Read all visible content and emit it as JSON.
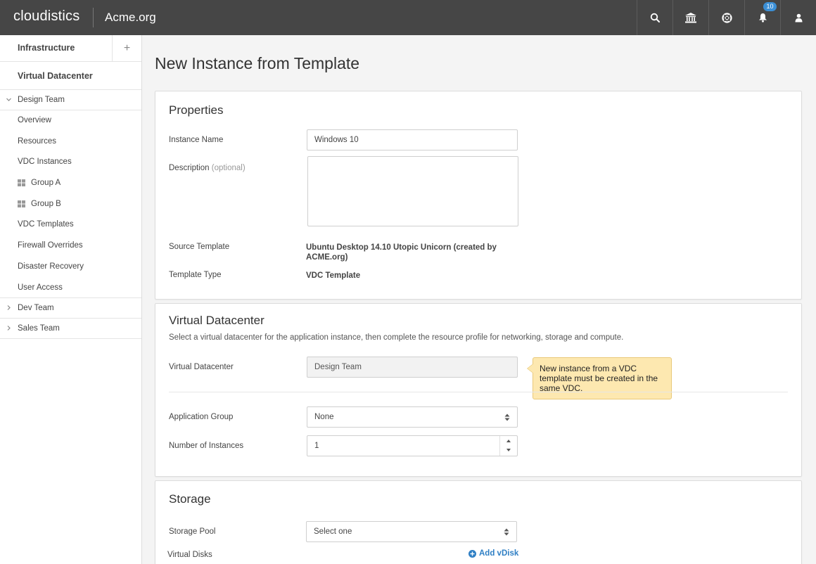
{
  "header": {
    "brand": "cloudistics",
    "org": "Acme.org",
    "notifications_count": "10",
    "icons": [
      "search-icon",
      "bank-icon",
      "lifebuoy-icon",
      "bell-icon",
      "user-icon"
    ]
  },
  "sidebar": {
    "infrastructure": "Infrastructure",
    "virtual_datacenter": "Virtual Datacenter",
    "teams": [
      {
        "label": "Design Team",
        "expanded": true,
        "items": [
          {
            "label": "Overview"
          },
          {
            "label": "Resources"
          },
          {
            "label": "VDC Instances"
          },
          {
            "label": "Group A",
            "icon": "grid-icon"
          },
          {
            "label": "Group B",
            "icon": "grid-icon"
          },
          {
            "label": "VDC Templates"
          },
          {
            "label": "Firewall Overrides"
          },
          {
            "label": "Disaster Recovery"
          },
          {
            "label": "User Access"
          }
        ]
      },
      {
        "label": "Dev Team",
        "expanded": false
      },
      {
        "label": "Sales Team",
        "expanded": false
      }
    ]
  },
  "page": {
    "title": "New Instance from Template"
  },
  "properties": {
    "heading": "Properties",
    "instance_name_label": "Instance Name",
    "instance_name_value": "Windows 10",
    "description_label": "Description",
    "description_optional": "(optional)",
    "source_template_label": "Source Template",
    "source_template_value": "Ubuntu Desktop 14.10 Utopic Unicorn (created by ACME.org)",
    "template_type_label": "Template Type",
    "template_type_value": "VDC Template"
  },
  "vdc": {
    "heading": "Virtual Datacenter",
    "description": "Select a virtual datacenter for the application instance, then complete the resource profile for networking, storage and compute.",
    "vdc_label": "Virtual Datacenter",
    "vdc_value": "Design Team",
    "tooltip": "New instance from a VDC template must be created in the same VDC.",
    "app_group_label": "Application Group",
    "app_group_value": "None",
    "num_instances_label": "Number of Instances",
    "num_instances_value": "1"
  },
  "storage": {
    "heading": "Storage",
    "storage_pool_label": "Storage Pool",
    "storage_pool_value": "Select one",
    "virtual_disks_label": "Virtual Disks",
    "add_vdisk": "Add vDisk"
  },
  "colors": {
    "topbar": "#464646",
    "accent": "#3b8fd6",
    "link": "#2f7fc4",
    "tooltip_bg": "#fde8b0"
  }
}
